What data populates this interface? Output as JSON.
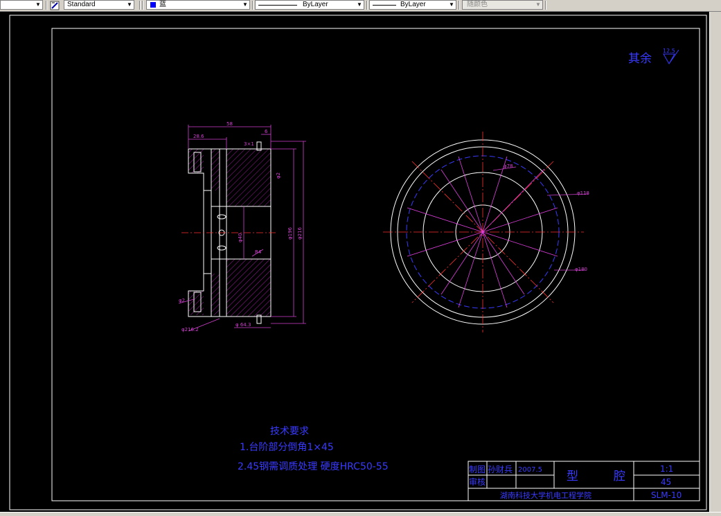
{
  "toolbar": {
    "textstyle_value": "Standard",
    "color_value": "蓝",
    "linetype_value": "ByLayer",
    "lineweight_value": "ByLayer",
    "plotstyle_value": "随颜色",
    "accent_color": "#0000ff"
  },
  "drawing": {
    "surface_finish": {
      "label": "其余",
      "value": "12.5"
    },
    "tech_requirements": {
      "title": "技术要求",
      "line1": "1.台阶部分倒角1×45",
      "line2": "2.45钢需调质处理 硬度HRC50-55"
    },
    "dims": {
      "top_overall": "58",
      "top_left": "28.6",
      "top_right": "6",
      "small_label": "3×1",
      "bottom_left": "φ216.2",
      "bottom_mid": "φ 64.3",
      "center_dim": "φ40",
      "right_dim1": "φ2",
      "right_inner": "φ196",
      "right_outer": "φ216",
      "left_small": "φ2",
      "mid_small": "R4",
      "circle_label1": "φ78",
      "circle_label2": "φ118",
      "circle_label3": "φ180"
    },
    "title_block": {
      "row1_label": "制图",
      "row1_name": "孙财兵",
      "row1_date": "2007.5",
      "row2_label": "审核",
      "part_name": "型　　　腔",
      "scale": "1:1",
      "material": "45",
      "school": "湖南科技大学机电工程学院",
      "drawing_no": "SLM-10"
    }
  }
}
